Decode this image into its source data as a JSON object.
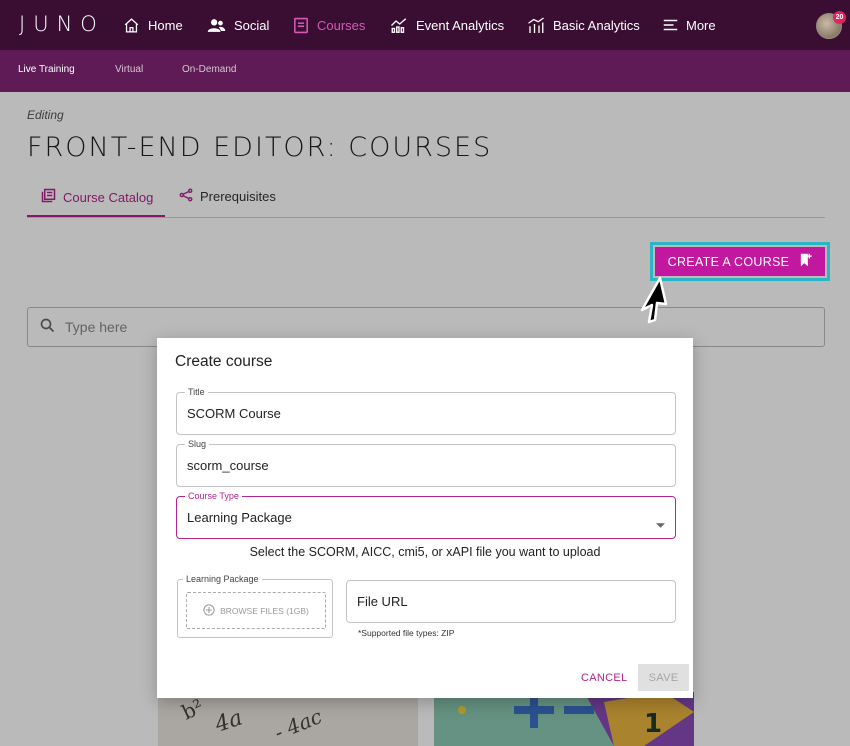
{
  "nav": {
    "logo": "JUNO",
    "items": [
      {
        "label": "Home",
        "icon": "home-icon"
      },
      {
        "label": "Social",
        "icon": "people-icon"
      },
      {
        "label": "Courses",
        "icon": "book-icon",
        "active": true
      },
      {
        "label": "Event Analytics",
        "icon": "event-analytics-icon"
      },
      {
        "label": "Basic Analytics",
        "icon": "bar-chart-icon"
      },
      {
        "label": "More",
        "icon": "menu-icon"
      }
    ],
    "notification_count": "20"
  },
  "subnav": {
    "items": [
      "Live Training",
      "Virtual",
      "On-Demand"
    ]
  },
  "page": {
    "editing_label": "Editing",
    "title": "FRONT-END EDITOR: COURSES",
    "tabs": [
      {
        "label": "Course Catalog",
        "icon": "catalog-icon"
      },
      {
        "label": "Prerequisites",
        "icon": "share-icon"
      }
    ],
    "create_button": "CREATE A COURSE",
    "search_placeholder": "Type here"
  },
  "modal": {
    "title": "Create course",
    "fields": {
      "title": {
        "label": "Title",
        "value": "SCORM Course"
      },
      "slug": {
        "label": "Slug",
        "value": "scorm_course"
      },
      "course_type": {
        "label": "Course Type",
        "value": "Learning Package"
      }
    },
    "hint": "Select the SCORM, AICC, cmi5, or xAPI file you want to upload",
    "learning_package": {
      "label": "Learning Package",
      "browse": "BROWSE FILES (1GB)"
    },
    "file_url": {
      "placeholder": "File URL",
      "note": "*Supported file types: ZIP"
    },
    "cancel": "CANCEL",
    "save": "SAVE"
  },
  "colors": {
    "nav_bg": "#3a0e32",
    "subnav_bg": "#5e1b55",
    "accent": "#b2248f",
    "create_button": "#c2189f",
    "highlight": "#2bb6c8"
  }
}
